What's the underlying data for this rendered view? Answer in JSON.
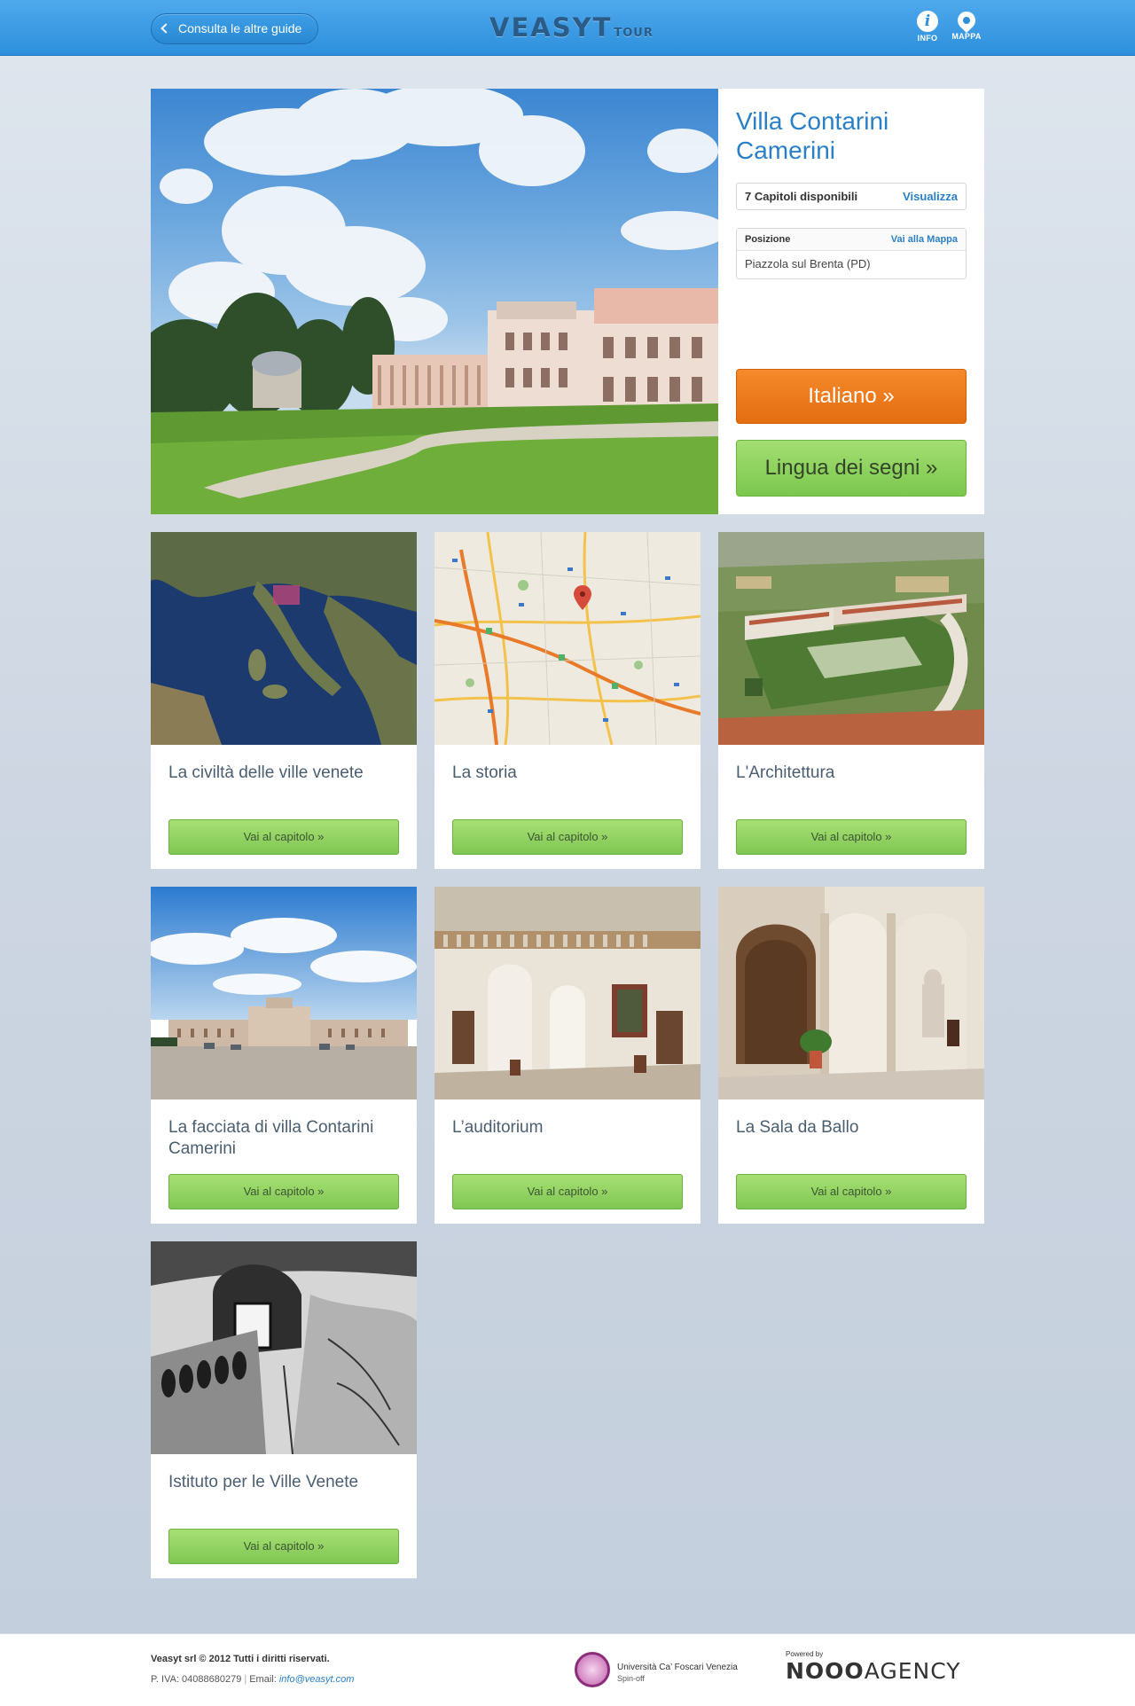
{
  "header": {
    "back_label": "Consulta le altre guide",
    "logo": "VEASYT",
    "logo_sub": "TOUR",
    "info_label": "INFO",
    "map_label": "MAPPA"
  },
  "hero": {
    "title": "Villa Contarini Camerini",
    "chapters_text": "7 Capitoli disponibili",
    "chapters_link": "Visualizza",
    "position_label": "Posizione",
    "position_link": "Vai alla Mappa",
    "position_value": "Piazzola sul Brenta (PD)",
    "btn_italian": "Italiano »",
    "btn_lis": "Lingua dei segni »"
  },
  "chapters": [
    {
      "title": "La civiltà delle ville venete",
      "button": "Vai al capitolo »"
    },
    {
      "title": "La storia",
      "button": "Vai al capitolo »"
    },
    {
      "title": "L'Architettura",
      "button": "Vai al capitolo »"
    },
    {
      "title": "La facciata di villa Contarini Camerini",
      "button": "Vai al capitolo »"
    },
    {
      "title": "L’auditorium",
      "button": "Vai al capitolo »"
    },
    {
      "title": "La Sala da Ballo",
      "button": "Vai al capitolo »"
    },
    {
      "title": "Istituto per le Ville Venete",
      "button": "Vai al capitolo »"
    }
  ],
  "footer": {
    "company": "Veasyt srl © 2012 Tutti i diritti riservati.",
    "piva": "P. IVA: 04088680279",
    "email_label": "Email:",
    "email": "info@veasyt.com",
    "university_line1": "Università Ca’ Foscari Venezia",
    "university_line2": "Spin-off",
    "powered_by": "Powered by",
    "agency_bold": "NOOO",
    "agency": "AGENCY"
  },
  "colors": {
    "header_blue": "#2d8fdc",
    "title_blue": "#2a7fc6",
    "orange_button": "#f07c1e",
    "green_button": "#8ed160"
  }
}
